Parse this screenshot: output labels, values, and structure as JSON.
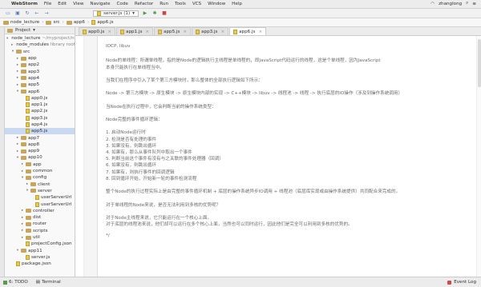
{
  "menubar": {
    "app_name": "WebStorm",
    "items": [
      "File",
      "Edit",
      "View",
      "Navigate",
      "Code",
      "Refactor",
      "Run",
      "Tools",
      "VCS",
      "Window",
      "Help"
    ],
    "window_title": "node_lecture [~/myproject/node_lecture] - .../src/app6/app6.js",
    "user": "zhanglong"
  },
  "toolbar": {
    "run_config": "server.js (1)"
  },
  "navbar": {
    "crumbs": [
      "node_lecture",
      "src",
      "app6",
      "app6.js"
    ]
  },
  "project_panel": {
    "title": "Project",
    "tree": [
      {
        "label": "node_lecture",
        "extra": "~/myproject/node_lecture",
        "indent": 0,
        "type": "folder",
        "open": true
      },
      {
        "label": "node_modules",
        "extra": "library root",
        "indent": 1,
        "type": "folder",
        "open": false
      },
      {
        "label": "src",
        "extra": "",
        "indent": 1,
        "type": "folder",
        "open": true
      },
      {
        "label": "app",
        "extra": "",
        "indent": 2,
        "type": "folder",
        "open": false
      },
      {
        "label": "app2",
        "extra": "",
        "indent": 2,
        "type": "folder",
        "open": false
      },
      {
        "label": "app3",
        "extra": "",
        "indent": 2,
        "type": "folder",
        "open": false
      },
      {
        "label": "app4",
        "extra": "",
        "indent": 2,
        "type": "folder",
        "open": false
      },
      {
        "label": "app5",
        "extra": "",
        "indent": 2,
        "type": "folder",
        "open": false
      },
      {
        "label": "app6",
        "extra": "",
        "indent": 2,
        "type": "folder",
        "open": true
      },
      {
        "label": "app0.js",
        "extra": "",
        "indent": 3,
        "type": "file"
      },
      {
        "label": "app1.js",
        "extra": "",
        "indent": 3,
        "type": "file"
      },
      {
        "label": "app2.js",
        "extra": "",
        "indent": 3,
        "type": "file"
      },
      {
        "label": "app3.js",
        "extra": "",
        "indent": 3,
        "type": "file"
      },
      {
        "label": "app4.js",
        "extra": "",
        "indent": 3,
        "type": "file"
      },
      {
        "label": "app5.js",
        "extra": "",
        "indent": 3,
        "type": "file",
        "selected": true
      },
      {
        "label": "app7",
        "extra": "",
        "indent": 2,
        "type": "folder",
        "open": false
      },
      {
        "label": "app8",
        "extra": "",
        "indent": 2,
        "type": "folder",
        "open": false
      },
      {
        "label": "app9",
        "extra": "",
        "indent": 2,
        "type": "folder",
        "open": false
      },
      {
        "label": "app10",
        "extra": "",
        "indent": 2,
        "type": "folder",
        "open": true
      },
      {
        "label": "app",
        "extra": "",
        "indent": 3,
        "type": "folder",
        "open": false
      },
      {
        "label": "common",
        "extra": "",
        "indent": 3,
        "type": "folder",
        "open": false
      },
      {
        "label": "config",
        "extra": "",
        "indent": 3,
        "type": "folder",
        "open": true
      },
      {
        "label": "client",
        "extra": "",
        "indent": 4,
        "type": "folder",
        "open": false
      },
      {
        "label": "server",
        "extra": "",
        "indent": 4,
        "type": "folder",
        "open": true
      },
      {
        "label": "userServerUrl",
        "extra": "",
        "indent": 5,
        "type": "file"
      },
      {
        "label": "userServerUrl",
        "extra": "",
        "indent": 5,
        "type": "file"
      },
      {
        "label": "controller",
        "extra": "",
        "indent": 3,
        "type": "folder",
        "open": false
      },
      {
        "label": "dist",
        "extra": "",
        "indent": 3,
        "type": "folder",
        "open": false
      },
      {
        "label": "router",
        "extra": "",
        "indent": 3,
        "type": "folder",
        "open": false
      },
      {
        "label": "scripts",
        "extra": "",
        "indent": 3,
        "type": "folder",
        "open": false
      },
      {
        "label": "util",
        "extra": "",
        "indent": 3,
        "type": "folder",
        "open": false
      },
      {
        "label": "projectConfig.json",
        "extra": "",
        "indent": 3,
        "type": "file"
      },
      {
        "label": "app11",
        "extra": "",
        "indent": 2,
        "type": "folder",
        "open": true
      },
      {
        "label": "server.js",
        "extra": "",
        "indent": 3,
        "type": "file"
      },
      {
        "label": "package.json",
        "extra": "",
        "indent": 1,
        "type": "file"
      }
    ]
  },
  "editor": {
    "tabs": [
      {
        "label": "app0.js",
        "active": false
      },
      {
        "label": "app1.js",
        "active": false
      },
      {
        "label": "app5.js",
        "active": false
      },
      {
        "label": "app3.js",
        "active": false
      },
      {
        "label": "app6.js",
        "active": true
      }
    ],
    "lines": [
      "IOCP, libuv",
      "",
      "Node的单线程：所谓单线程，指的是Node的逻辑执行主线程是单线程的，即JavaScript代码运行的线程，这是个单线程，因为JavaScript",
      "本身只能执行在单线程当中。",
      "",
      "当我们在程序中引入了某个第三方模块时，那么整体的全部执行逻辑如下所示：",
      "",
      "Node -> 第三方模块 -> 原生模块 -> 原生模块内部的实现 -> C++模块 -> libuv -> 线程池 -> 线程 -> 执行底层的IO操作（涉及到操作系统调用）",
      "",
      "当Node在执行过程中，它会判断当前的操作系统类型：",
      "",
      "Node完整的事件循环逻辑：",
      "",
      "1. 启动Node运行时",
      "2. 检测是否有处理的事件",
      "3. 如果没有，则跳出循环",
      "4. 如果有，那么从事件队列中取出一个事件",
      "5. 判断当前这个事件有没有与之关联的事件处理器（回调）",
      "6. 如果没有，则跳出循环",
      "7. 如果有，则执行事件的回调逻辑",
      "8. 回到循环开始，开始新一轮的事件检测流程",
      "",
      "整个Node的执行过程实际上是由完整的事件循环机制 + 底层的操作系统异步IO调用 + 线程池（底层库实现或由操作系统提供）共同配合来完成的。",
      "",
      "对于单线程的Node来说，是否无法利用到多核的优势呢？",
      "",
      "对于Node主线程来说，它只能运行在一个核心上面。",
      "对于底层的线程池来说，他们却可以运行在多个核心上面，当然也可以同时运行，因此他们是完全可以利用到多核的优势的。",
      "",
      "*/"
    ]
  },
  "statusbar": {
    "todo": "6: TODO",
    "terminal": "Terminal",
    "event_log": "Event Log"
  }
}
